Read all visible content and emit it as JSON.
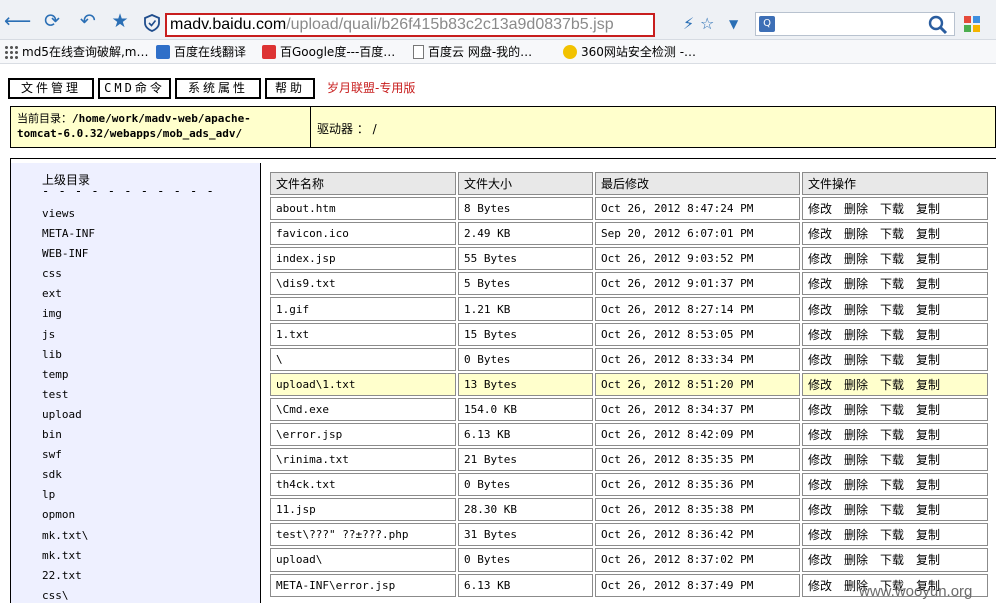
{
  "browser": {
    "url_host": "madv.baidu.com",
    "url_path": "/upload/quali/b26f415b83c2c13a9d0837b5.jsp",
    "url_prefix": "",
    "search_value": ""
  },
  "bookmarks": [
    {
      "label": "md5在线查询破解,m…",
      "icon": "grid-icon"
    },
    {
      "label": "百度在线翻译",
      "icon": "translate-icon"
    },
    {
      "label": "百Google度---百度…",
      "icon": "search-icon"
    },
    {
      "label": "百度云 网盘-我的…",
      "icon": "page-icon"
    },
    {
      "label": "360网站安全检测 -…",
      "icon": "shield-plus-icon"
    }
  ],
  "menu": {
    "file_mgmt": "文件管理",
    "cmd": "CMD命令",
    "sys_props": "系统属性",
    "help": "帮助",
    "brand": "岁月联盟-专用版"
  },
  "dirbar": {
    "current_label": "当前目录：",
    "current_path_1": "/home/work/madv-web/apache-",
    "current_path_2": "tomcat-6.0.32/webapps/mob_ads_adv/",
    "drive": "驱动器 ： /"
  },
  "sidebar": {
    "parent": "上级目录",
    "dashes": "- - - - - - - - - - -",
    "dirs": [
      "views",
      "META-INF",
      "WEB-INF",
      "css",
      "ext",
      "img",
      "js",
      "lib",
      "temp",
      "test",
      "upload",
      "bin",
      "swf",
      "sdk",
      "lp",
      "opmon",
      "mk.txt\\",
      "mk.txt",
      "22.txt",
      "css\\"
    ]
  },
  "table": {
    "headers": [
      "文件名称",
      "文件大小",
      "最后修改",
      "文件操作"
    ],
    "ops": [
      "修改",
      "删除",
      "下载",
      "复制"
    ],
    "rows": [
      {
        "name": "about.htm",
        "size": "8 Bytes",
        "modified": "Oct 26, 2012 8:47:24 PM"
      },
      {
        "name": "favicon.ico",
        "size": "2.49 KB",
        "modified": "Sep 20, 2012 6:07:01 PM"
      },
      {
        "name": "index.jsp",
        "size": "55 Bytes",
        "modified": "Oct 26, 2012 9:03:52 PM"
      },
      {
        "name": "\\dis9.txt",
        "size": "5 Bytes",
        "modified": "Oct 26, 2012 9:01:37 PM"
      },
      {
        "name": "1.gif",
        "size": "1.21 KB",
        "modified": "Oct 26, 2012 8:27:14 PM"
      },
      {
        "name": "1.txt",
        "size": "15 Bytes",
        "modified": "Oct 26, 2012 8:53:05 PM"
      },
      {
        "name": "\\",
        "size": "0 Bytes",
        "modified": "Oct 26, 2012 8:33:34 PM"
      },
      {
        "name": "upload\\1.txt",
        "size": "13 Bytes",
        "modified": "Oct 26, 2012 8:51:20 PM"
      },
      {
        "name": "\\Cmd.exe",
        "size": "154.0 KB",
        "modified": "Oct 26, 2012 8:34:37 PM"
      },
      {
        "name": "\\error.jsp",
        "size": "6.13 KB",
        "modified": "Oct 26, 2012 8:42:09 PM"
      },
      {
        "name": "\\rinima.txt",
        "size": "21 Bytes",
        "modified": "Oct 26, 2012 8:35:35 PM"
      },
      {
        "name": "th4ck.txt",
        "size": "0 Bytes",
        "modified": "Oct 26, 2012 8:35:36 PM"
      },
      {
        "name": "11.jsp",
        "size": "28.30 KB",
        "modified": "Oct 26, 2012 8:35:38 PM"
      },
      {
        "name": "test\\???\" ??±???.php",
        "size": "31 Bytes",
        "modified": "Oct 26, 2012 8:36:42 PM"
      },
      {
        "name": "upload\\",
        "size": "0 Bytes",
        "modified": "Oct 26, 2012 8:37:02 PM"
      },
      {
        "name": "META-INF\\error.jsp",
        "size": "6.13 KB",
        "modified": "Oct 26, 2012 8:37:49 PM"
      }
    ],
    "highlight_index": 7
  },
  "watermark": "www.wooyun.org",
  "colors": {
    "dir_bar_bg": "#ffffcc",
    "sidebar_bg": "#eef0ff",
    "header_bg": "#e8e8e8",
    "brand": "#c81e1e",
    "address_outline": "#c81e1e"
  }
}
